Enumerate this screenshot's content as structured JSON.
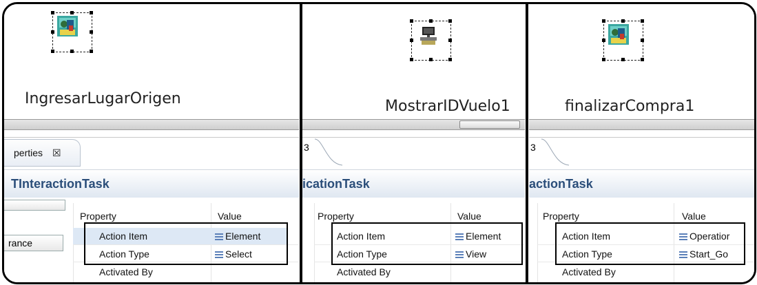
{
  "panels": [
    {
      "node_label": "IngresarLugarOrigen",
      "tab_label": "perties",
      "tab_close": "☒",
      "title": "TInteractionTask",
      "side_tab": "rance",
      "header_property": "Property",
      "header_value": "Value",
      "rows": [
        {
          "name": "Action Item",
          "value": "Element"
        },
        {
          "name": "Action Type",
          "value": "Select"
        },
        {
          "name": "Activated By",
          "value": ""
        }
      ]
    },
    {
      "node_label": "MostrarIDVuelo1",
      "tab_label": "3",
      "title": "icationTask",
      "header_property": "Property",
      "header_value": "Value",
      "rows": [
        {
          "name": "Action Item",
          "value": "Element"
        },
        {
          "name": "Action Type",
          "value": "View"
        },
        {
          "name": "Activated By",
          "value": ""
        }
      ]
    },
    {
      "node_label": "finalizarCompra1",
      "tab_label": "3",
      "title": "actionTask",
      "header_property": "Property",
      "header_value": "Value",
      "rows": [
        {
          "name": "Action Item",
          "value": "Operatior"
        },
        {
          "name": "Action Type",
          "value": "Start_Go"
        },
        {
          "name": "Activated By",
          "value": ""
        }
      ]
    }
  ],
  "icons": {
    "node1": "user-interaction-task-icon",
    "node2": "application-task-icon",
    "node3": "user-interaction-task-icon",
    "enum": "enum-literal-icon"
  },
  "colors": {
    "title_text": "#2b4e7a",
    "selection_row": "#dde8f5"
  }
}
